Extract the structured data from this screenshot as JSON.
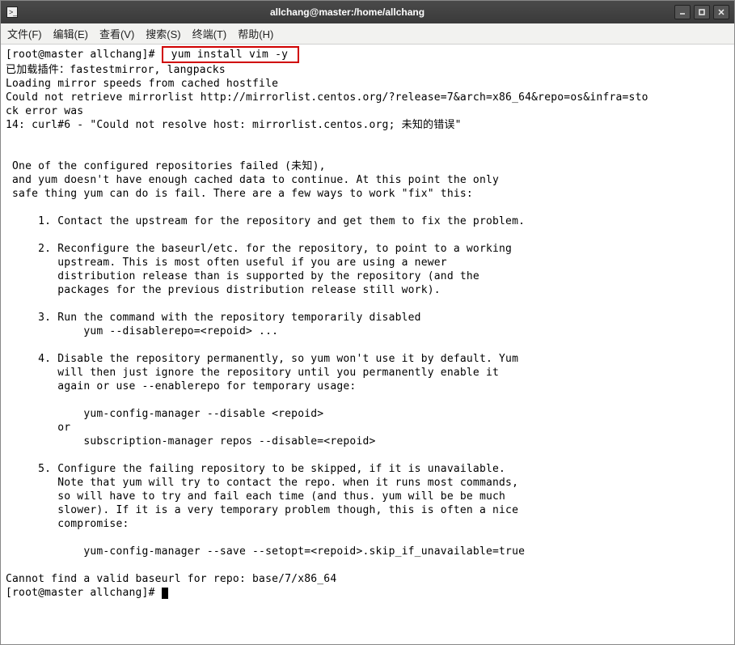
{
  "window": {
    "title": "allchang@master:/home/allchang"
  },
  "menu": {
    "file": "文件(F)",
    "edit": "编辑(E)",
    "view": "查看(V)",
    "search": "搜索(S)",
    "terminal": "终端(T)",
    "help": "帮助(H)"
  },
  "term": {
    "prompt1": "[root@master allchang]# ",
    "cmd": " yum install vim -y ",
    "l1": "已加载插件：fastestmirror, langpacks",
    "l2": "Loading mirror speeds from cached hostfile",
    "l3": "Could not retrieve mirrorlist http://mirrorlist.centos.org/?release=7&arch=x86_64&repo=os&infra=sto",
    "l3b": "ck error was",
    "l4": "14: curl#6 - \"Could not resolve host: mirrorlist.centos.org; 未知的错误\"",
    "blank": "",
    "p1": " One of the configured repositories failed (未知),",
    "p2": " and yum doesn't have enough cached data to continue. At this point the only",
    "p3": " safe thing yum can do is fail. There are a few ways to work \"fix\" this:",
    "i1a": "     1. Contact the upstream for the repository and get them to fix the problem.",
    "i2a": "     2. Reconfigure the baseurl/etc. for the repository, to point to a working",
    "i2b": "        upstream. This is most often useful if you are using a newer",
    "i2c": "        distribution release than is supported by the repository (and the",
    "i2d": "        packages for the previous distribution release still work).",
    "i3a": "     3. Run the command with the repository temporarily disabled",
    "i3b": "            yum --disablerepo=<repoid> ...",
    "i4a": "     4. Disable the repository permanently, so yum won't use it by default. Yum",
    "i4b": "        will then just ignore the repository until you permanently enable it",
    "i4c": "        again or use --enablerepo for temporary usage:",
    "i4d": "            yum-config-manager --disable <repoid>",
    "i4e": "        or",
    "i4f": "            subscription-manager repos --disable=<repoid>",
    "i5a": "     5. Configure the failing repository to be skipped, if it is unavailable.",
    "i5b": "        Note that yum will try to contact the repo. when it runs most commands,",
    "i5c": "        so will have to try and fail each time (and thus. yum will be be much",
    "i5d": "        slower). If it is a very temporary problem though, this is often a nice",
    "i5e": "        compromise:",
    "i5f": "            yum-config-manager --save --setopt=<repoid>.skip_if_unavailable=true",
    "e1": "Cannot find a valid baseurl for repo: base/7/x86_64",
    "prompt2": "[root@master allchang]# "
  }
}
